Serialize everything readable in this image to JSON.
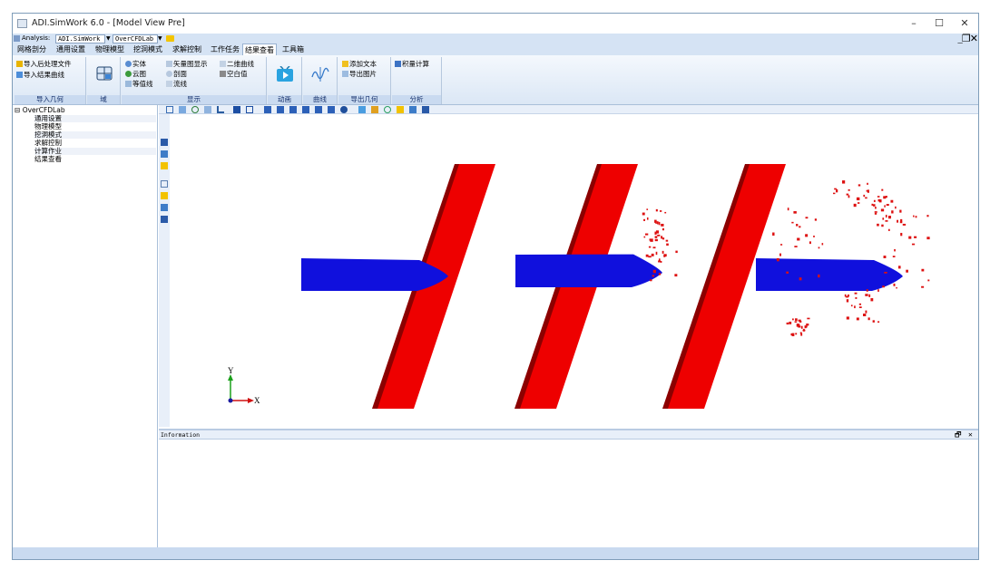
{
  "window": {
    "title": "ADI.SimWork 6.0 - [Model View Pre]",
    "minimize": "–",
    "maximize": "☐",
    "close": "✕"
  },
  "menu": {
    "analysis_label": "Analysis:",
    "analysis_value": "ADI.SimWork",
    "case_value": "OverCFDLab",
    "mdi_controls": "_❐✕"
  },
  "tabs": [
    "网格剖分",
    "通用设置",
    "物理模型",
    "挖洞模式",
    "求解控制",
    "工作任务",
    "结果查看",
    "工具箱"
  ],
  "active_tab": "结果查看",
  "ribbon": {
    "import": {
      "label": "导入几何",
      "items": [
        "导入后处理文件",
        "导入结果曲线"
      ]
    },
    "domain": {
      "label": "域"
    },
    "display": {
      "label": "显示",
      "items": [
        "实体",
        "云图",
        "等值线",
        "矢量图显示",
        "剖面",
        "流线",
        "二维曲线",
        "空白值"
      ]
    },
    "animation": {
      "label": "动画"
    },
    "curve": {
      "label": "曲线"
    },
    "export": {
      "label": "导出几何",
      "items": [
        "添加文本",
        "导出图片"
      ]
    },
    "analysis": {
      "label": "分析",
      "items": [
        "积量计算"
      ]
    }
  },
  "tree": {
    "root": "OverCFDLab",
    "expander": "⊟",
    "children": [
      "通用设置",
      "物理模型",
      "挖洞模式",
      "求解控制",
      "计算作业",
      "结果查看"
    ]
  },
  "axes": {
    "x": "X",
    "y": "Y"
  },
  "info": {
    "title": "Information",
    "restore": "🗗",
    "close": "✕"
  },
  "colors": {
    "body": "#ee0000",
    "shadow": "#8c0000",
    "projectile": "#1010dd",
    "spray": "#dd1010"
  }
}
